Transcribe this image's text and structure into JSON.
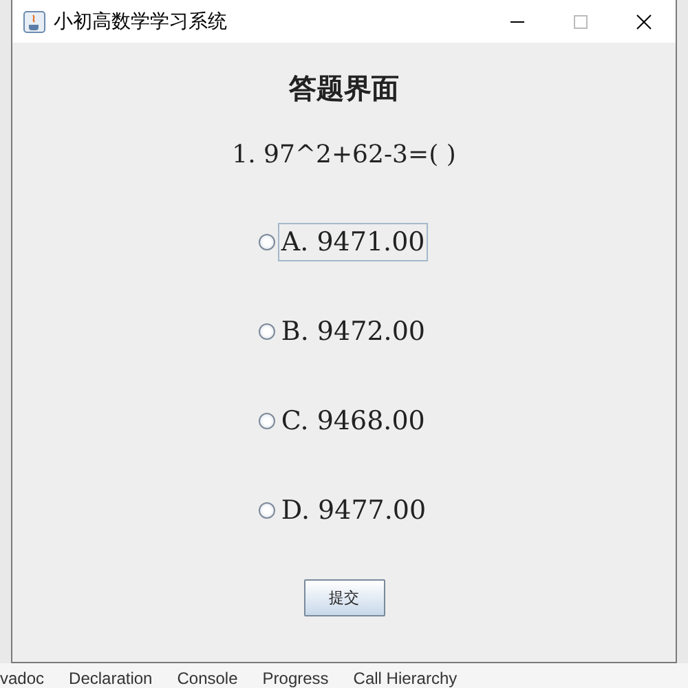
{
  "window": {
    "title": "小初高数学学习系统"
  },
  "heading": "答题界面",
  "question": "1. 97^2+62-3=( )",
  "options": [
    {
      "letter": "A.",
      "value": "9471.00",
      "selected": false,
      "focused": true
    },
    {
      "letter": "B.",
      "value": "9472.00",
      "selected": false,
      "focused": false
    },
    {
      "letter": "C.",
      "value": "9468.00",
      "selected": false,
      "focused": false
    },
    {
      "letter": "D.",
      "value": "9477.00",
      "selected": false,
      "focused": false
    }
  ],
  "submit": "提交",
  "background_tabs": [
    "vadoc",
    "Declaration",
    "Console",
    "Progress",
    "Call Hierarchy"
  ]
}
